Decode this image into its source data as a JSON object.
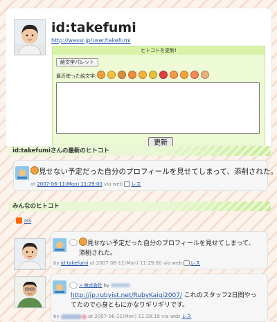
{
  "profile": {
    "username": "id:takefumi",
    "url": "http://wassr.jp/user/takefumi"
  },
  "update_box": {
    "title": "ヒトコトを更新!",
    "emoji_palette_button": "絵文字パレット",
    "recent_emoji_label": "最近使った絵文字:",
    "recent_emoji": [
      {
        "icon": "sad-face-icon",
        "color": "#f0a040"
      },
      {
        "icon": "smile-face-icon",
        "color": "#f6c23c"
      },
      {
        "icon": "building-icon",
        "color": "#d98c3c"
      },
      {
        "icon": "angry-face-icon",
        "color": "#f08c3c"
      },
      {
        "icon": "surprised-face-icon",
        "color": "#f7b23c"
      },
      {
        "icon": "bottle-icon",
        "color": "#e5c23c"
      },
      {
        "icon": "house-icon",
        "color": "#e04040"
      },
      {
        "icon": "blush-face-icon",
        "color": "#f59a4a"
      },
      {
        "icon": "laugh-face-icon",
        "color": "#f4a43a"
      },
      {
        "icon": "flower-face-icon",
        "color": "#f28a5a"
      },
      {
        "icon": "cake-icon",
        "color": "#e8b07a"
      }
    ],
    "textarea_value": "",
    "submit_label": "更新"
  },
  "latest": {
    "header": "id:takefumiさんの最新のヒトコト",
    "text": "見せない予定だった自分のプロフィールを見せてしまって、添削された。",
    "meta_at": "at",
    "timestamp": "2007-06-11(Mon) 11:29:00",
    "via": "via web",
    "reply_label": "レス"
  },
  "everyone": {
    "header": "みんなのヒトコト",
    "rss_label": "rss",
    "posts": [
      {
        "text": "見せない予定だった自分のプロフィールを見せてしまって、添削された。",
        "by": "by",
        "author": "id:takefumi",
        "at": "at 2007-06-11(Mon) 11:29:00",
        "via": "via web",
        "reply_label": "レス"
      },
      {
        "reply_prefix": "> 株式会社",
        "reply_by": "by",
        "link": "http://jp.rubyist.net/RubyKaigi2007/",
        "text": "これのスタッフ2日間やってたので心身ともにかなりギリギリです。",
        "by": "by",
        "at": "at 2007-06-11(Mon) 11:28:19",
        "via": "via web",
        "reply_label": "レス"
      }
    ]
  }
}
